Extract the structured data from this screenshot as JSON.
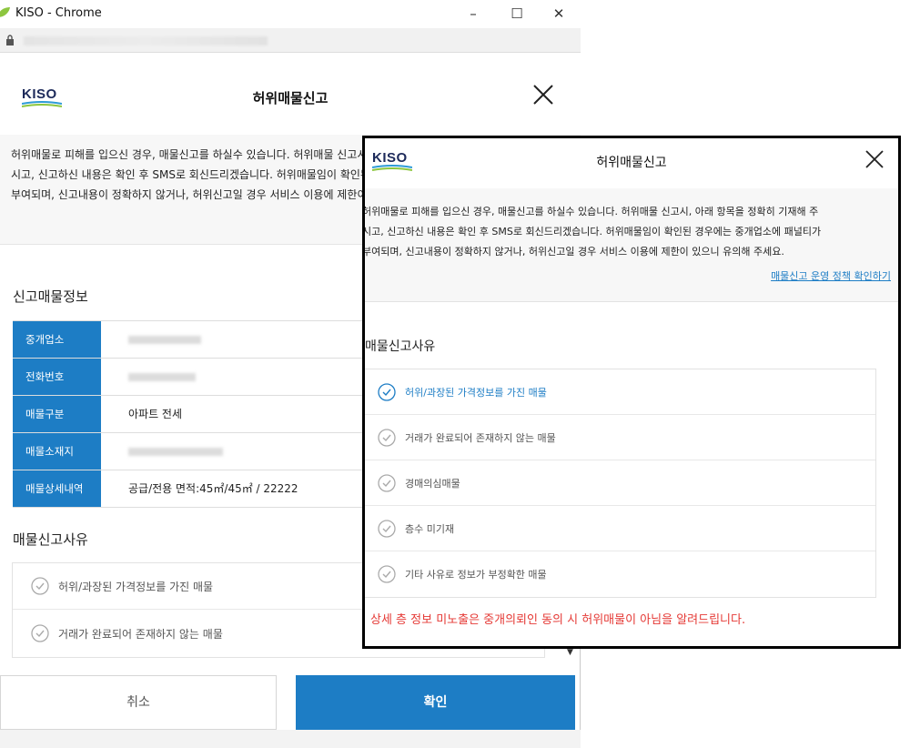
{
  "window": {
    "title": "KISO - Chrome",
    "controls": {
      "minimize": "–",
      "maximize": "☐",
      "close": "✕"
    }
  },
  "brand": {
    "logo_text": "KISO"
  },
  "dialog": {
    "title": "허위매물신고",
    "notice_lines": [
      "허위매물로 피해를 입으신 경우, 매물신고를 하실수 있습니다. 허위매물 신고시, 아래 항목을 정확히 기재해 주",
      "시고, 신고하신 내용은 확인 후 SMS로 회신드리겠습니다. 허위매물임이 확인된 경우에는 중개업소에 패널티가",
      "부여되며, 신고내용이 정확하지 않거나, 허위신고일 경우 서비스 이용에 제한이 있으니 유의해 주세요."
    ],
    "policy_link": "매물신고 운영 정책 확인하기",
    "info_section_title": "신고매물정보",
    "info_rows": [
      {
        "label": "중개업소",
        "value": ""
      },
      {
        "label": "전화번호",
        "value": ""
      },
      {
        "label": "매물구분",
        "value": "아파트 전세"
      },
      {
        "label": "매물소재지",
        "value": ""
      },
      {
        "label": "매물상세내역",
        "value": "공급/전용 면적:45㎡/45㎡ / 22222"
      }
    ],
    "reason_section_title": "매물신고사유",
    "reasons": [
      "허위/과장된 가격정보를 가진 매물",
      "거래가 완료되어 존재하지 않는 매물",
      "경매의심매물",
      "층수 미기재",
      "기타 사유로 정보가 부정확한 매물"
    ],
    "selected_reason_index": 0,
    "warning": "상세 층 정보 미노출은 중개의뢰인 동의 시 허위매물이 아님을 알려드립니다.",
    "buttons": {
      "cancel": "취소",
      "confirm": "확인"
    }
  },
  "colors": {
    "accent": "#1d7dc5",
    "warning": "#e53935",
    "notice_bg": "#f7f7f7"
  },
  "icons": [
    "leaf-app-icon",
    "lock-icon",
    "close-icon",
    "check-circle-icon"
  ]
}
